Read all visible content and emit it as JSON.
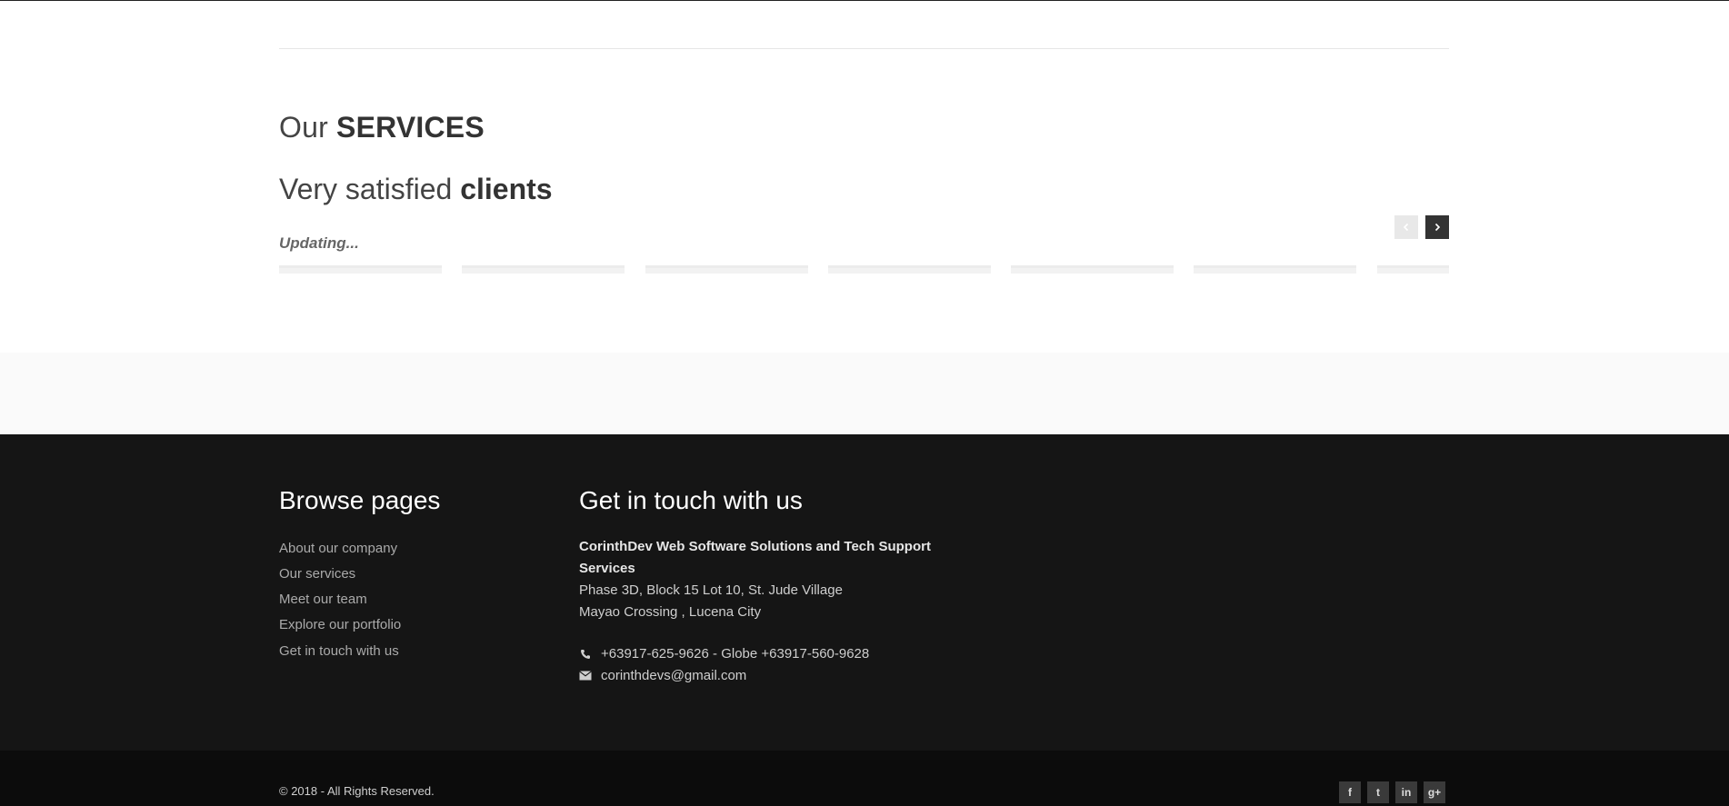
{
  "services": {
    "heading_light": "Our",
    "heading_bold": "SERVICES"
  },
  "clients": {
    "heading_light": "Very satisfied",
    "heading_bold": "clients",
    "status": "Updating...",
    "prev_label": "‹",
    "next_label": "›"
  },
  "footer": {
    "browse": {
      "title": "Browse pages",
      "links": [
        "About our company",
        "Our services",
        "Meet our team",
        "Explore our portfolio",
        "Get in touch with us"
      ]
    },
    "contact": {
      "title": "Get in touch with us",
      "company_name": "CorinthDev Web Software Solutions and Tech Support Services",
      "address_line1": "Phase 3D, Block 15 Lot 10, St. Jude Village",
      "address_line2": "Mayao Crossing , Lucena City",
      "phone": "+63917-625-9626 - Globe +63917-560-9628",
      "email": "corinthdevs@gmail.com"
    }
  },
  "bottom": {
    "copyright": "© 2018 - All Rights Reserved.",
    "social": [
      {
        "icon": "facebook-icon",
        "glyph": "f"
      },
      {
        "icon": "twitter-icon",
        "glyph": "t"
      },
      {
        "icon": "linkedin-icon",
        "glyph": "in"
      },
      {
        "icon": "google-plus-icon",
        "glyph": "g+"
      }
    ]
  },
  "colors": {
    "footer_bg": "#151515",
    "bottom_bg": "#0c0c0c",
    "text_dark": "#333333"
  }
}
